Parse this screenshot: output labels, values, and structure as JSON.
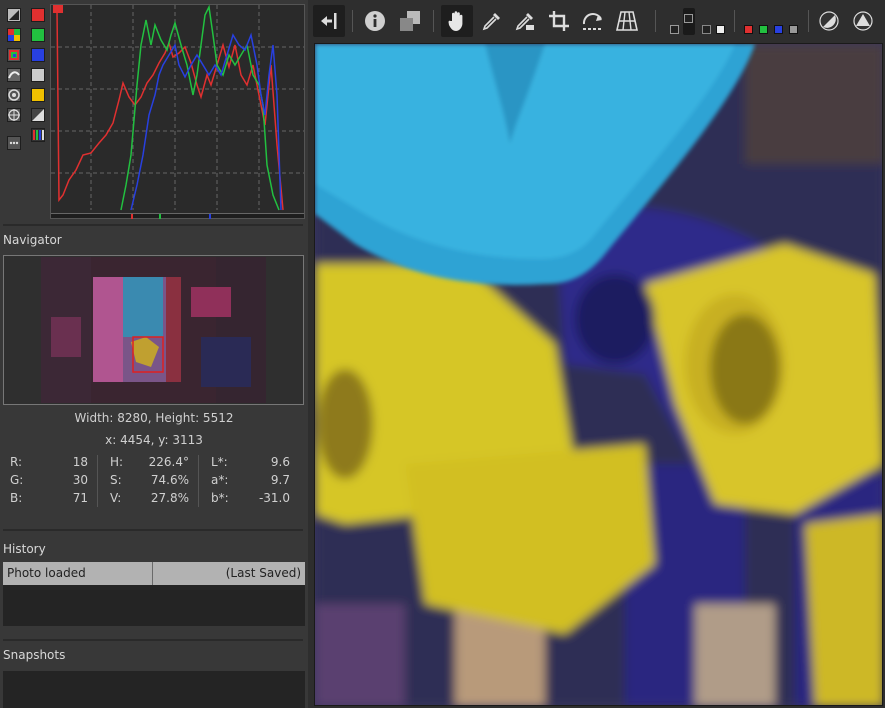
{
  "navigator": {
    "title": "Navigator",
    "size_text": "Width: 8280, Height: 5512",
    "coords_text": "x: 4454, y: 3113"
  },
  "pixel_values": {
    "rgb": [
      {
        "label": "R:",
        "value": "18"
      },
      {
        "label": "G:",
        "value": "30"
      },
      {
        "label": "B:",
        "value": "71"
      }
    ],
    "hsv": [
      {
        "label": "H:",
        "value": "226.4°"
      },
      {
        "label": "S:",
        "value": "74.6%"
      },
      {
        "label": "V:",
        "value": "27.8%"
      }
    ],
    "lab": [
      {
        "label": "L*:",
        "value": "9.6"
      },
      {
        "label": "a*:",
        "value": "9.7"
      },
      {
        "label": "b*:",
        "value": "-31.0"
      }
    ]
  },
  "history": {
    "title": "History",
    "col_photo": "Photo loaded",
    "col_saved": "(Last Saved)"
  },
  "snapshots": {
    "title": "Snapshots"
  },
  "colors": {
    "red": "#e03030",
    "green": "#22c040",
    "blue": "#2840e0",
    "yellow": "#f0c000",
    "accent_bg": "#1e1e1e"
  },
  "toolbar": {
    "icons": [
      "panel-toggle-icon",
      "info-icon",
      "before-after-icon",
      "hand-icon",
      "color-picker-icon",
      "white-balance-picker-icon",
      "crop-icon",
      "rotate-straighten-icon",
      "perspective-icon",
      "preview-mode-icon",
      "channel-red-icon",
      "channel-green-icon",
      "channel-blue-icon",
      "channel-luminance-icon",
      "focus-mask-icon",
      "clipping-indicator-icon"
    ]
  }
}
